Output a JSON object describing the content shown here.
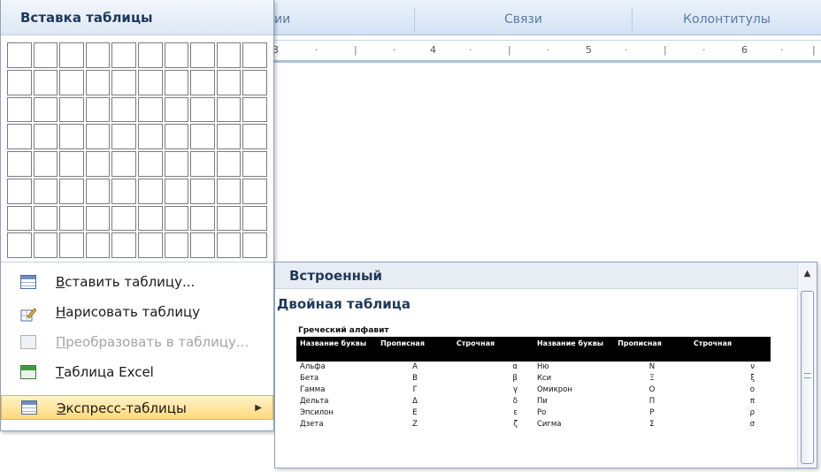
{
  "ribbon": {
    "groups": [
      "ии",
      "Связи",
      "Колонтитулы"
    ]
  },
  "ruler": {
    "numbers": [
      "3",
      "4",
      "5",
      "6"
    ]
  },
  "insert_panel": {
    "title": "Вставка таблицы",
    "menu": [
      {
        "underline": "В",
        "rest": "ставить таблицу...",
        "icon": "table-icon",
        "state": "normal"
      },
      {
        "underline": "Н",
        "rest": "арисовать таблицу",
        "icon": "pencil-table-icon",
        "state": "normal"
      },
      {
        "underline": "П",
        "rest": "реобразовать в таблицу...",
        "icon": "convert-table-icon",
        "state": "disabled"
      },
      {
        "underline": "Т",
        "rest": "аблица Excel",
        "icon": "excel-table-icon",
        "state": "normal"
      },
      {
        "underline": "Э",
        "rest": "кспресс-таблицы",
        "icon": "quick-tables-icon",
        "state": "active"
      }
    ]
  },
  "gallery": {
    "section": "Встроенный",
    "item_title": "Двойная таблица",
    "preview": {
      "caption": "Греческий алфавит",
      "headers": [
        "Название буквы",
        "Прописная",
        "Строчная",
        "Название буквы",
        "Прописная",
        "Строчная"
      ],
      "rows": [
        [
          "Альфа",
          "Α",
          "α",
          "Ню",
          "Ν",
          "ν"
        ],
        [
          "Бета",
          "Β",
          "β",
          "Кси",
          "Ξ",
          "ξ"
        ],
        [
          "Гамма",
          "Γ",
          "γ",
          "Омикрон",
          "Ο",
          "ο"
        ],
        [
          "Дельта",
          "Δ",
          "δ",
          "Пи",
          "Π",
          "π"
        ],
        [
          "Эпсилон",
          "Ε",
          "ε",
          "Ро",
          "Ρ",
          "ρ"
        ],
        [
          "Дзета",
          "Ζ",
          "ζ",
          "Сигма",
          "Σ",
          "σ"
        ]
      ]
    }
  },
  "colors": {
    "accent_blue": "#1e395b",
    "hover_gold": "#ffd97a"
  }
}
